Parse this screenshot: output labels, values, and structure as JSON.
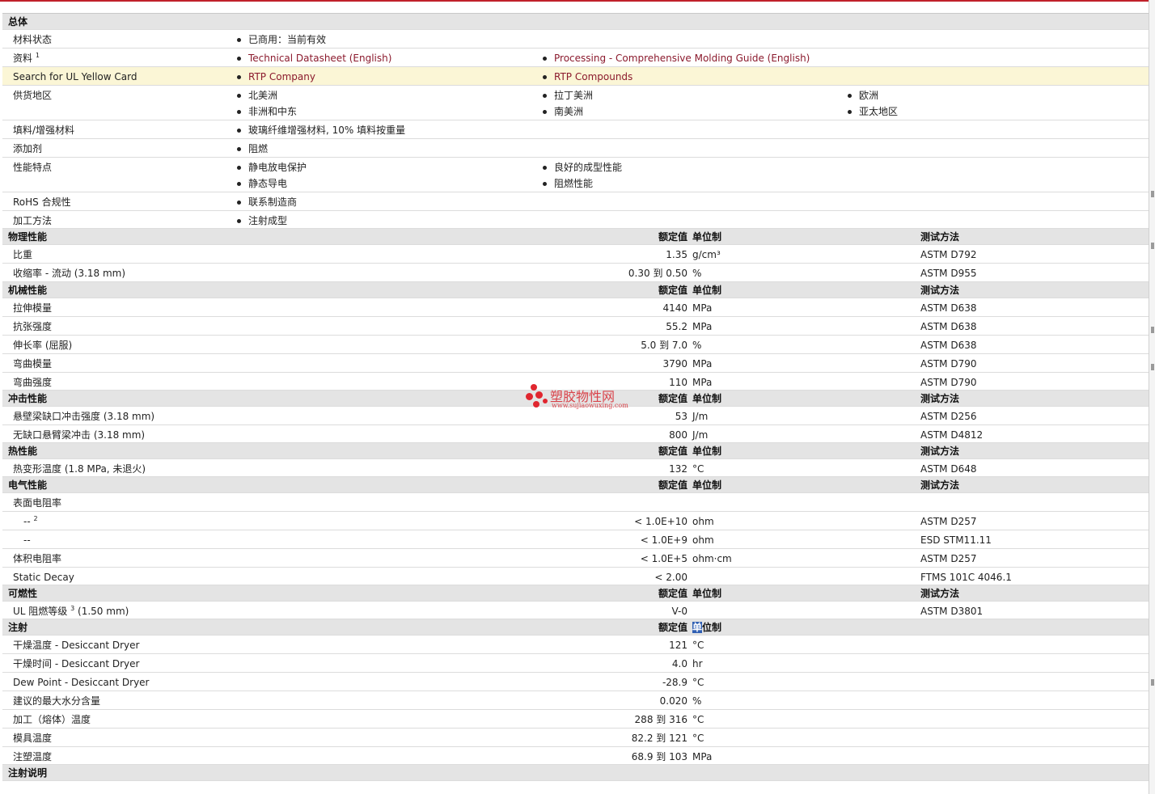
{
  "colors": {
    "accent": "#c0202a",
    "link": "#8b1a2d",
    "section_bg": "#e4e4e4",
    "highlight_row": "#fbf6d6"
  },
  "col_headers": {
    "value": "额定值",
    "unit": "单位制",
    "method": "测试方法"
  },
  "general": {
    "title": "总体",
    "status_label": "材料状态",
    "status_value": "已商用：当前有效",
    "docs_label": "资料",
    "docs_sup": "1",
    "docs": [
      "Technical Datasheet (English)",
      "Processing - Comprehensive Molding Guide (English)"
    ],
    "ul_label": "Search for UL Yellow Card",
    "ul_links": [
      "RTP Company",
      "RTP Compounds"
    ],
    "regions_label": "供货地区",
    "regions": [
      "北美洲",
      "拉丁美洲",
      "欧洲",
      "非洲和中东",
      "南美洲",
      "亚太地区"
    ],
    "filler_label": "填料/增强材料",
    "filler_value": "玻璃纤维增强材料, 10% 填料按重量",
    "additive_label": "添加剂",
    "additive_value": "阻燃",
    "features_label": "性能特点",
    "features": [
      "静电放电保护",
      "良好的成型性能",
      "静态导电",
      "阻燃性能"
    ],
    "rohs_label": "RoHS 合规性",
    "rohs_value": "联系制造商",
    "process_label": "加工方法",
    "process_value": "注射成型"
  },
  "physical": {
    "title": "物理性能",
    "rows": [
      {
        "name": "比重",
        "value": "1.35",
        "unit": "g/cm³",
        "method": "ASTM D792"
      },
      {
        "name": "收缩率  - 流动  (3.18 mm)",
        "value": "0.30 到  0.50",
        "unit": "%",
        "method": "ASTM D955"
      }
    ]
  },
  "mechanical": {
    "title": "机械性能",
    "rows": [
      {
        "name": "拉伸模量",
        "value": "4140",
        "unit": "MPa",
        "method": "ASTM D638"
      },
      {
        "name": "抗张强度",
        "value": "55.2",
        "unit": "MPa",
        "method": "ASTM D638"
      },
      {
        "name": "伸长率  (屈服)",
        "value": "5.0 到  7.0",
        "unit": "%",
        "method": "ASTM D638"
      },
      {
        "name": "弯曲模量",
        "value": "3790",
        "unit": "MPa",
        "method": "ASTM D790"
      },
      {
        "name": "弯曲强度",
        "value": "110",
        "unit": "MPa",
        "method": "ASTM D790"
      }
    ]
  },
  "impact": {
    "title": "冲击性能",
    "rows": [
      {
        "name": "悬壁梁缺口冲击强度  (3.18 mm)",
        "value": "53",
        "unit": "J/m",
        "method": "ASTM D256"
      },
      {
        "name": "无缺口悬臂梁冲击  (3.18 mm)",
        "value": "800",
        "unit": "J/m",
        "method": "ASTM D4812"
      }
    ]
  },
  "thermal": {
    "title": "热性能",
    "rows": [
      {
        "name": "热变形温度  (1.8 MPa, 未退火)",
        "value": "132",
        "unit": "°C",
        "method": "ASTM D648"
      }
    ]
  },
  "electrical": {
    "title": "电气性能",
    "surface_label": "表面电阻率",
    "sub1_name": "--",
    "sub1_sup": "2",
    "sub1_value": "< 1.0E+10",
    "sub1_unit": "ohm",
    "sub1_method": "ASTM D257",
    "sub2_name": "--",
    "sub2_value": "< 1.0E+9",
    "sub2_unit": "ohm",
    "sub2_method": "ESD STM11.11",
    "rows": [
      {
        "name": "体积电阻率",
        "value": "< 1.0E+5",
        "unit": "ohm·cm",
        "method": "ASTM D257"
      },
      {
        "name": "Static Decay",
        "value": "< 2.00",
        "unit": "",
        "method": "FTMS 101C 4046.1"
      }
    ]
  },
  "flammability": {
    "title": "可燃性",
    "name": "UL 阻燃等级",
    "sup": "3",
    "name_suffix": " (1.50 mm)",
    "value": "V-0",
    "method": "ASTM D3801"
  },
  "injection": {
    "title": "注射",
    "unit_header_first": "单",
    "unit_header_rest": "位制",
    "rows": [
      {
        "name": "干燥温度  - Desiccant Dryer",
        "value": "121",
        "unit": "°C"
      },
      {
        "name": "干燥时间  - Desiccant Dryer",
        "value": "4.0",
        "unit": "hr"
      },
      {
        "name": "Dew Point - Desiccant Dryer",
        "value": "-28.9",
        "unit": "°C"
      },
      {
        "name": "建议的最大水分含量",
        "value": "0.020",
        "unit": "%"
      },
      {
        "name": "加工（熔体）温度",
        "value": "288 到  316",
        "unit": "°C"
      },
      {
        "name": "模具温度",
        "value": "82.2 到  121",
        "unit": "°C"
      },
      {
        "name": "注塑温度",
        "value": "68.9 到  103",
        "unit": "MPa"
      }
    ]
  },
  "injection_notes": {
    "title": "注射说明"
  },
  "watermark": {
    "title": "塑胶物性网",
    "url": "www.sujiaowuxing.com"
  }
}
